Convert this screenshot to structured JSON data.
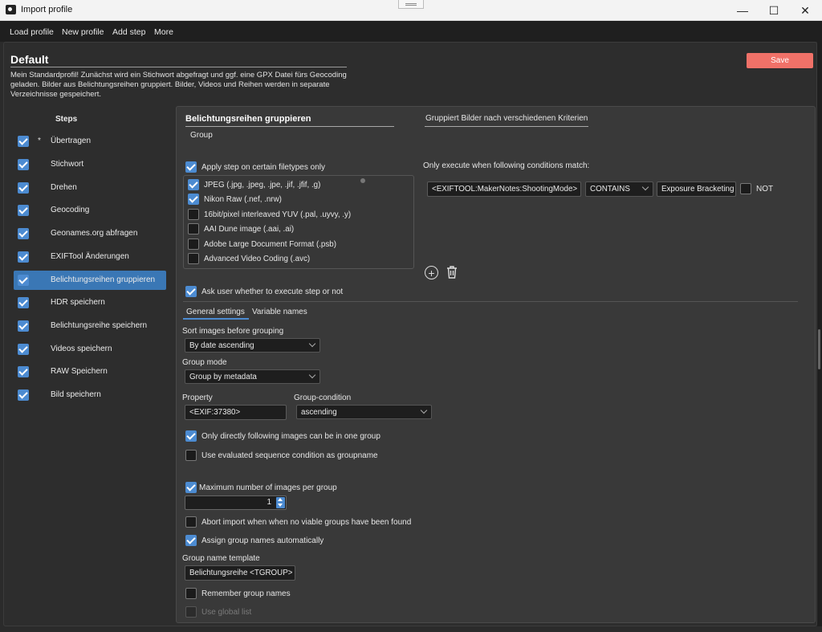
{
  "window": {
    "title": "Import profile",
    "minimize": "—",
    "maximize": "☐",
    "close": "✕"
  },
  "menu": [
    "Load profile",
    "New profile",
    "Add step",
    "More"
  ],
  "profile": {
    "name": "Default",
    "description": "Mein Standardprofil! Zunächst wird ein Stichwort abgefragt und ggf. eine GPX Datei fürs Geocoding geladen. Bilder aus Belichtungsreihen gruppiert. Bilder, Videos und Reihen werden in separate Verzeichnisse gespeichert.",
    "save_label": "Save"
  },
  "steps": {
    "title": "Steps",
    "items": [
      {
        "label": "Übertragen",
        "star": "*",
        "checked": true
      },
      {
        "label": "Stichwort",
        "checked": true
      },
      {
        "label": "Drehen",
        "checked": true
      },
      {
        "label": "Geocoding",
        "checked": true
      },
      {
        "label": "Geonames.org abfragen",
        "checked": true
      },
      {
        "label": "EXIFTool Änderungen",
        "checked": true
      },
      {
        "label": "Belichtungsreihen gruppieren",
        "checked": true,
        "active": true
      },
      {
        "label": "HDR speichern",
        "checked": true
      },
      {
        "label": "Belichtungsreihe speichern",
        "checked": true
      },
      {
        "label": "Videos speichern",
        "checked": true
      },
      {
        "label": "RAW Speichern",
        "checked": true
      },
      {
        "label": "Bild speichern",
        "checked": true
      }
    ]
  },
  "step_detail": {
    "title": "Belichtungsreihen gruppieren",
    "type": "Group",
    "description": "Gruppiert Bilder nach verschiedenen Kriterien",
    "filetype_only_label": "Apply step on certain filetypes only",
    "filetypes": [
      {
        "label": "JPEG (.jpg, .jpeg, .jpe, .jif, .jfif, .g)",
        "checked": true
      },
      {
        "label": "Nikon Raw (.nef, .nrw)",
        "checked": true
      },
      {
        "label": "16bit/pixel interleaved YUV (.pal, .uyvy, .y)",
        "checked": false
      },
      {
        "label": "AAI Dune image (.aai, .ai)",
        "checked": false
      },
      {
        "label": "Adobe Large Document Format (.psb)",
        "checked": false
      },
      {
        "label": "Advanced Video Coding (.avc)",
        "checked": false
      }
    ],
    "conditions_label": "Only execute when following conditions match:",
    "condition": {
      "field": "<EXIFTOOL:MakerNotes:ShootingMode>",
      "operator": "CONTAINS",
      "value": "Exposure Bracketing",
      "not_label": "NOT"
    },
    "ask_user_label": "Ask user whether to execute step or not",
    "tabs": [
      "General settings",
      "Variable names"
    ],
    "sort_label": "Sort images before grouping",
    "sort_value": "By date ascending",
    "group_mode_label": "Group mode",
    "group_mode_value": "Group by metadata",
    "property_label": "Property",
    "property_value": "<EXIF:37380>",
    "group_condition_label": "Group-condition",
    "group_condition_value": "ascending",
    "only_following_label": "Only directly following images can be in one group",
    "use_evaluated_label": "Use evaluated sequence condition as groupname",
    "max_images_label": "Maximum number of images per group",
    "max_images_value": "1",
    "abort_label": "Abort import when when no viable groups have been found",
    "assign_names_label": "Assign group names automatically",
    "template_label": "Group name template",
    "template_value": "Belichtungsreihe <TGROUP>",
    "remember_label": "Remember group names",
    "global_list_label": "Use global list"
  },
  "colors": {
    "accent": "#4c8bd1",
    "save": "#f07168",
    "active_step": "#3a77b5"
  }
}
